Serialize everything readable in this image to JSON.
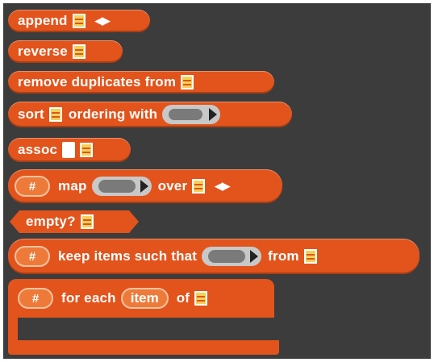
{
  "palette": {
    "blocks": {
      "append": {
        "label": "append",
        "arrows": "◀▶"
      },
      "reverse": {
        "label": "reverse"
      },
      "remove_duplicates": {
        "label": "remove duplicates from"
      },
      "sort": {
        "label": "sort",
        "label2": "ordering with"
      },
      "assoc": {
        "label": "assoc"
      },
      "map": {
        "hash": "#",
        "label": "map",
        "label2": "over",
        "arrows": "◀▶"
      },
      "empty": {
        "label": "empty?"
      },
      "keep": {
        "hash": "#",
        "label": "keep items such that",
        "label2": "from"
      },
      "for_each": {
        "hash": "#",
        "label": "for each",
        "var": "item",
        "label2": "of"
      }
    }
  },
  "colors": {
    "block": "#e2541c",
    "background": "#3c3c3c",
    "slot": "#f3d15a"
  }
}
